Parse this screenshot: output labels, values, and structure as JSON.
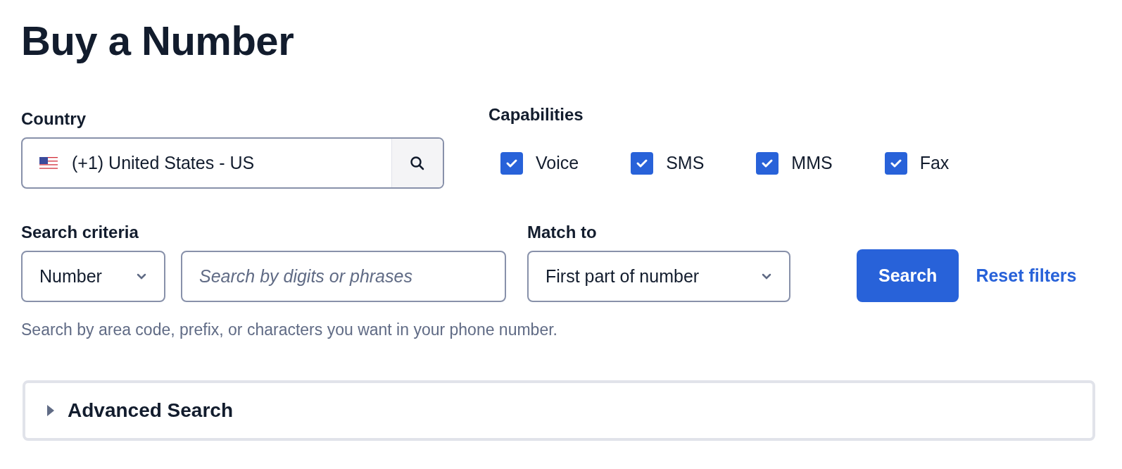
{
  "title": "Buy a Number",
  "country": {
    "label": "Country",
    "value": "(+1) United States - US"
  },
  "capabilities": {
    "label": "Capabilities",
    "options": [
      {
        "label": "Voice",
        "checked": true
      },
      {
        "label": "SMS",
        "checked": true
      },
      {
        "label": "MMS",
        "checked": true
      },
      {
        "label": "Fax",
        "checked": true
      }
    ]
  },
  "search_criteria": {
    "label": "Search criteria",
    "type_value": "Number",
    "placeholder": "Search by digits or phrases",
    "help": "Search by area code, prefix, or characters you want in your phone number."
  },
  "match_to": {
    "label": "Match to",
    "value": "First part of number"
  },
  "buttons": {
    "search": "Search",
    "reset": "Reset filters"
  },
  "advanced": {
    "label": "Advanced Search",
    "expanded": false
  }
}
